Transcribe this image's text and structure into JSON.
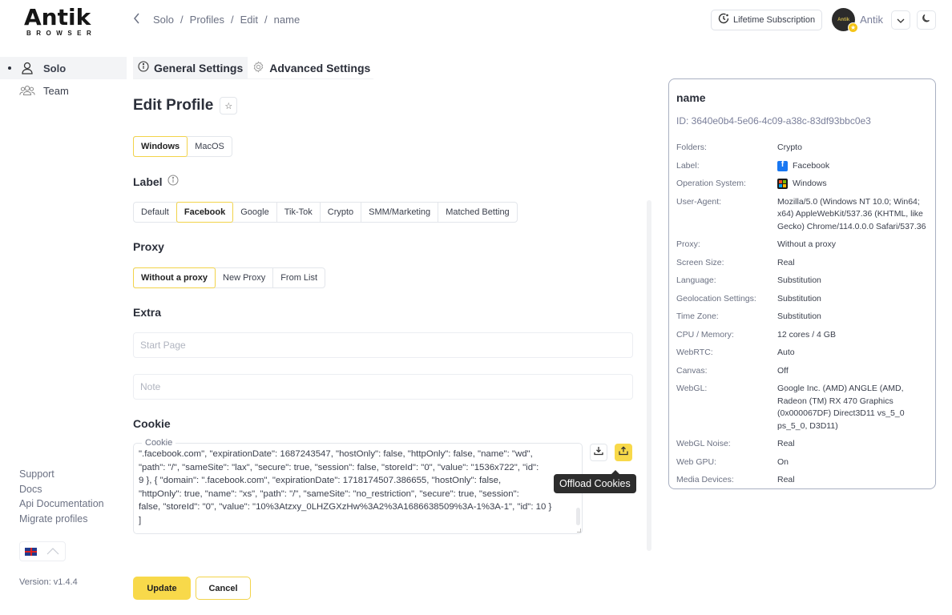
{
  "brand": {
    "logo_text": "Antik",
    "logo_sub": "BROWSER"
  },
  "sidebar": {
    "items": [
      {
        "label": "Solo",
        "icon": "user-icon",
        "active": true
      },
      {
        "label": "Team",
        "icon": "users-icon",
        "active": false
      }
    ],
    "links": [
      "Support",
      "Docs",
      "Api Documentation",
      "Migrate profiles"
    ],
    "language": "en-GB",
    "version": "Version: v1.4.4"
  },
  "breadcrumb": [
    "Solo",
    "Profiles",
    "Edit",
    "name"
  ],
  "header": {
    "subscription_label": "Lifetime Subscription",
    "avatar_text": "Antik",
    "user_name": "Antik"
  },
  "tabs": [
    {
      "label": "General Settings",
      "icon": "info-icon",
      "active": true
    },
    {
      "label": "Advanced Settings",
      "icon": "gear-icon",
      "active": false
    }
  ],
  "form": {
    "title": "Edit Profile",
    "os_options": [
      "Windows",
      "MacOS"
    ],
    "os_selected": "Windows",
    "label_heading": "Label",
    "label_options": [
      "Default",
      "Facebook",
      "Google",
      "Tik-Tok",
      "Crypto",
      "SMM/Marketing",
      "Matched Betting"
    ],
    "label_selected": "Facebook",
    "proxy_heading": "Proxy",
    "proxy_options": [
      "Without a proxy",
      "New Proxy",
      "From List"
    ],
    "proxy_selected": "Without a proxy",
    "extra_heading": "Extra",
    "start_page": {
      "value": "",
      "placeholder": "Start Page"
    },
    "note": {
      "value": "",
      "placeholder": "Note"
    },
    "cookie_heading": "Cookie",
    "cookie_legend": "Cookie",
    "cookie_text": "\".facebook.com\", \"expirationDate\": 1687243547, \"hostOnly\": false, \"httpOnly\": false, \"name\": \"wd\",\n\"path\": \"/\", \"sameSite\": \"lax\", \"secure\": true, \"session\": false, \"storeId\": \"0\", \"value\": \"1536x722\", \"id\":\n9 }, { \"domain\": \".facebook.com\", \"expirationDate\": 1718174507.386655, \"hostOnly\": false,\n\"httpOnly\": true, \"name\": \"xs\", \"path\": \"/\", \"sameSite\": \"no_restriction\", \"secure\": true, \"session\":\nfalse, \"storeId\": \"0\", \"value\": \"10%3Atzxy_0LHZGXzHw%3A2%3A1686638509%3A-1%3A-1\", \"id\": 10 }\n]",
    "offload_tooltip": "Offload Cookies",
    "update_label": "Update",
    "cancel_label": "Cancel"
  },
  "card": {
    "title": "name",
    "id_text": "ID: 3640e0b4-5e06-4c09-a38c-83df93bbc0e3",
    "rows": [
      {
        "key": "Folders:",
        "value": "Crypto"
      },
      {
        "key": "Label:",
        "value": "Facebook",
        "icon": "facebook-icon"
      },
      {
        "key": "Operation System:",
        "value": "Windows",
        "icon": "windows-icon"
      },
      {
        "key": "User-Agent:",
        "value": "Mozilla/5.0 (Windows NT 10.0; Win64; x64) AppleWebKit/537.36 (KHTML, like Gecko) Chrome/114.0.0.0 Safari/537.36"
      },
      {
        "key": "Proxy:",
        "value": "Without a proxy"
      },
      {
        "key": "Screen Size:",
        "value": "Real"
      },
      {
        "key": "Language:",
        "value": "Substitution"
      },
      {
        "key": "Geolocation Settings:",
        "value": "Substitution"
      },
      {
        "key": "Time Zone:",
        "value": "Substitution"
      },
      {
        "key": "CPU / Memory:",
        "value": "12 cores / 4 GB"
      },
      {
        "key": "WebRTC:",
        "value": "Auto"
      },
      {
        "key": "Canvas:",
        "value": "Off"
      },
      {
        "key": "WebGL:",
        "value": "Google Inc. (AMD) ANGLE (AMD, Radeon (TM) RX 470 Graphics (0x000067DF) Direct3D11 vs_5_0 ps_5_0, D3D11)"
      },
      {
        "key": "WebGL Noise:",
        "value": "Real"
      },
      {
        "key": "Web GPU:",
        "value": "On"
      },
      {
        "key": "Media Devices:",
        "value": "Real"
      }
    ]
  },
  "colors": {
    "accent": "#f8d94a",
    "accent_border": "#f2d34a",
    "card_border": "#a9b0c2",
    "tooltip_bg": "#2d2d2d"
  }
}
